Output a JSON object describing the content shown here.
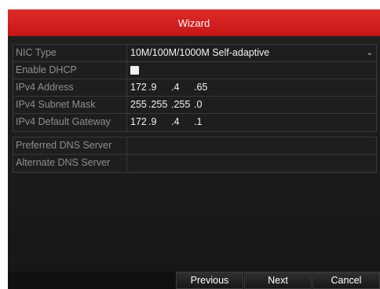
{
  "window": {
    "title": "Wizard"
  },
  "network": {
    "nic_type": {
      "label": "NIC Type",
      "value": "10M/100M/1000M Self-adaptive"
    },
    "dhcp": {
      "label": "Enable DHCP",
      "checked": false
    },
    "ipv4_address": {
      "label": "IPv4 Address",
      "octets": [
        "172",
        "9",
        "4",
        "65"
      ]
    },
    "subnet_mask": {
      "label": "IPv4 Subnet Mask",
      "octets": [
        "255",
        "255",
        "255",
        "0"
      ]
    },
    "default_gateway": {
      "label": "IPv4 Default Gateway",
      "octets": [
        "172",
        "9",
        "4",
        "1"
      ]
    }
  },
  "dns": {
    "preferred": {
      "label": "Preferred DNS Server",
      "value": ""
    },
    "alternate": {
      "label": "Alternate DNS Server",
      "value": ""
    }
  },
  "buttons": {
    "previous": "Previous",
    "next": "Next",
    "cancel": "Cancel"
  },
  "colors": {
    "title_bar": "#d42020",
    "dialog_bg": "#1c1c1c",
    "label_text": "#8e8e8e",
    "value_text": "#f2f2f2"
  }
}
